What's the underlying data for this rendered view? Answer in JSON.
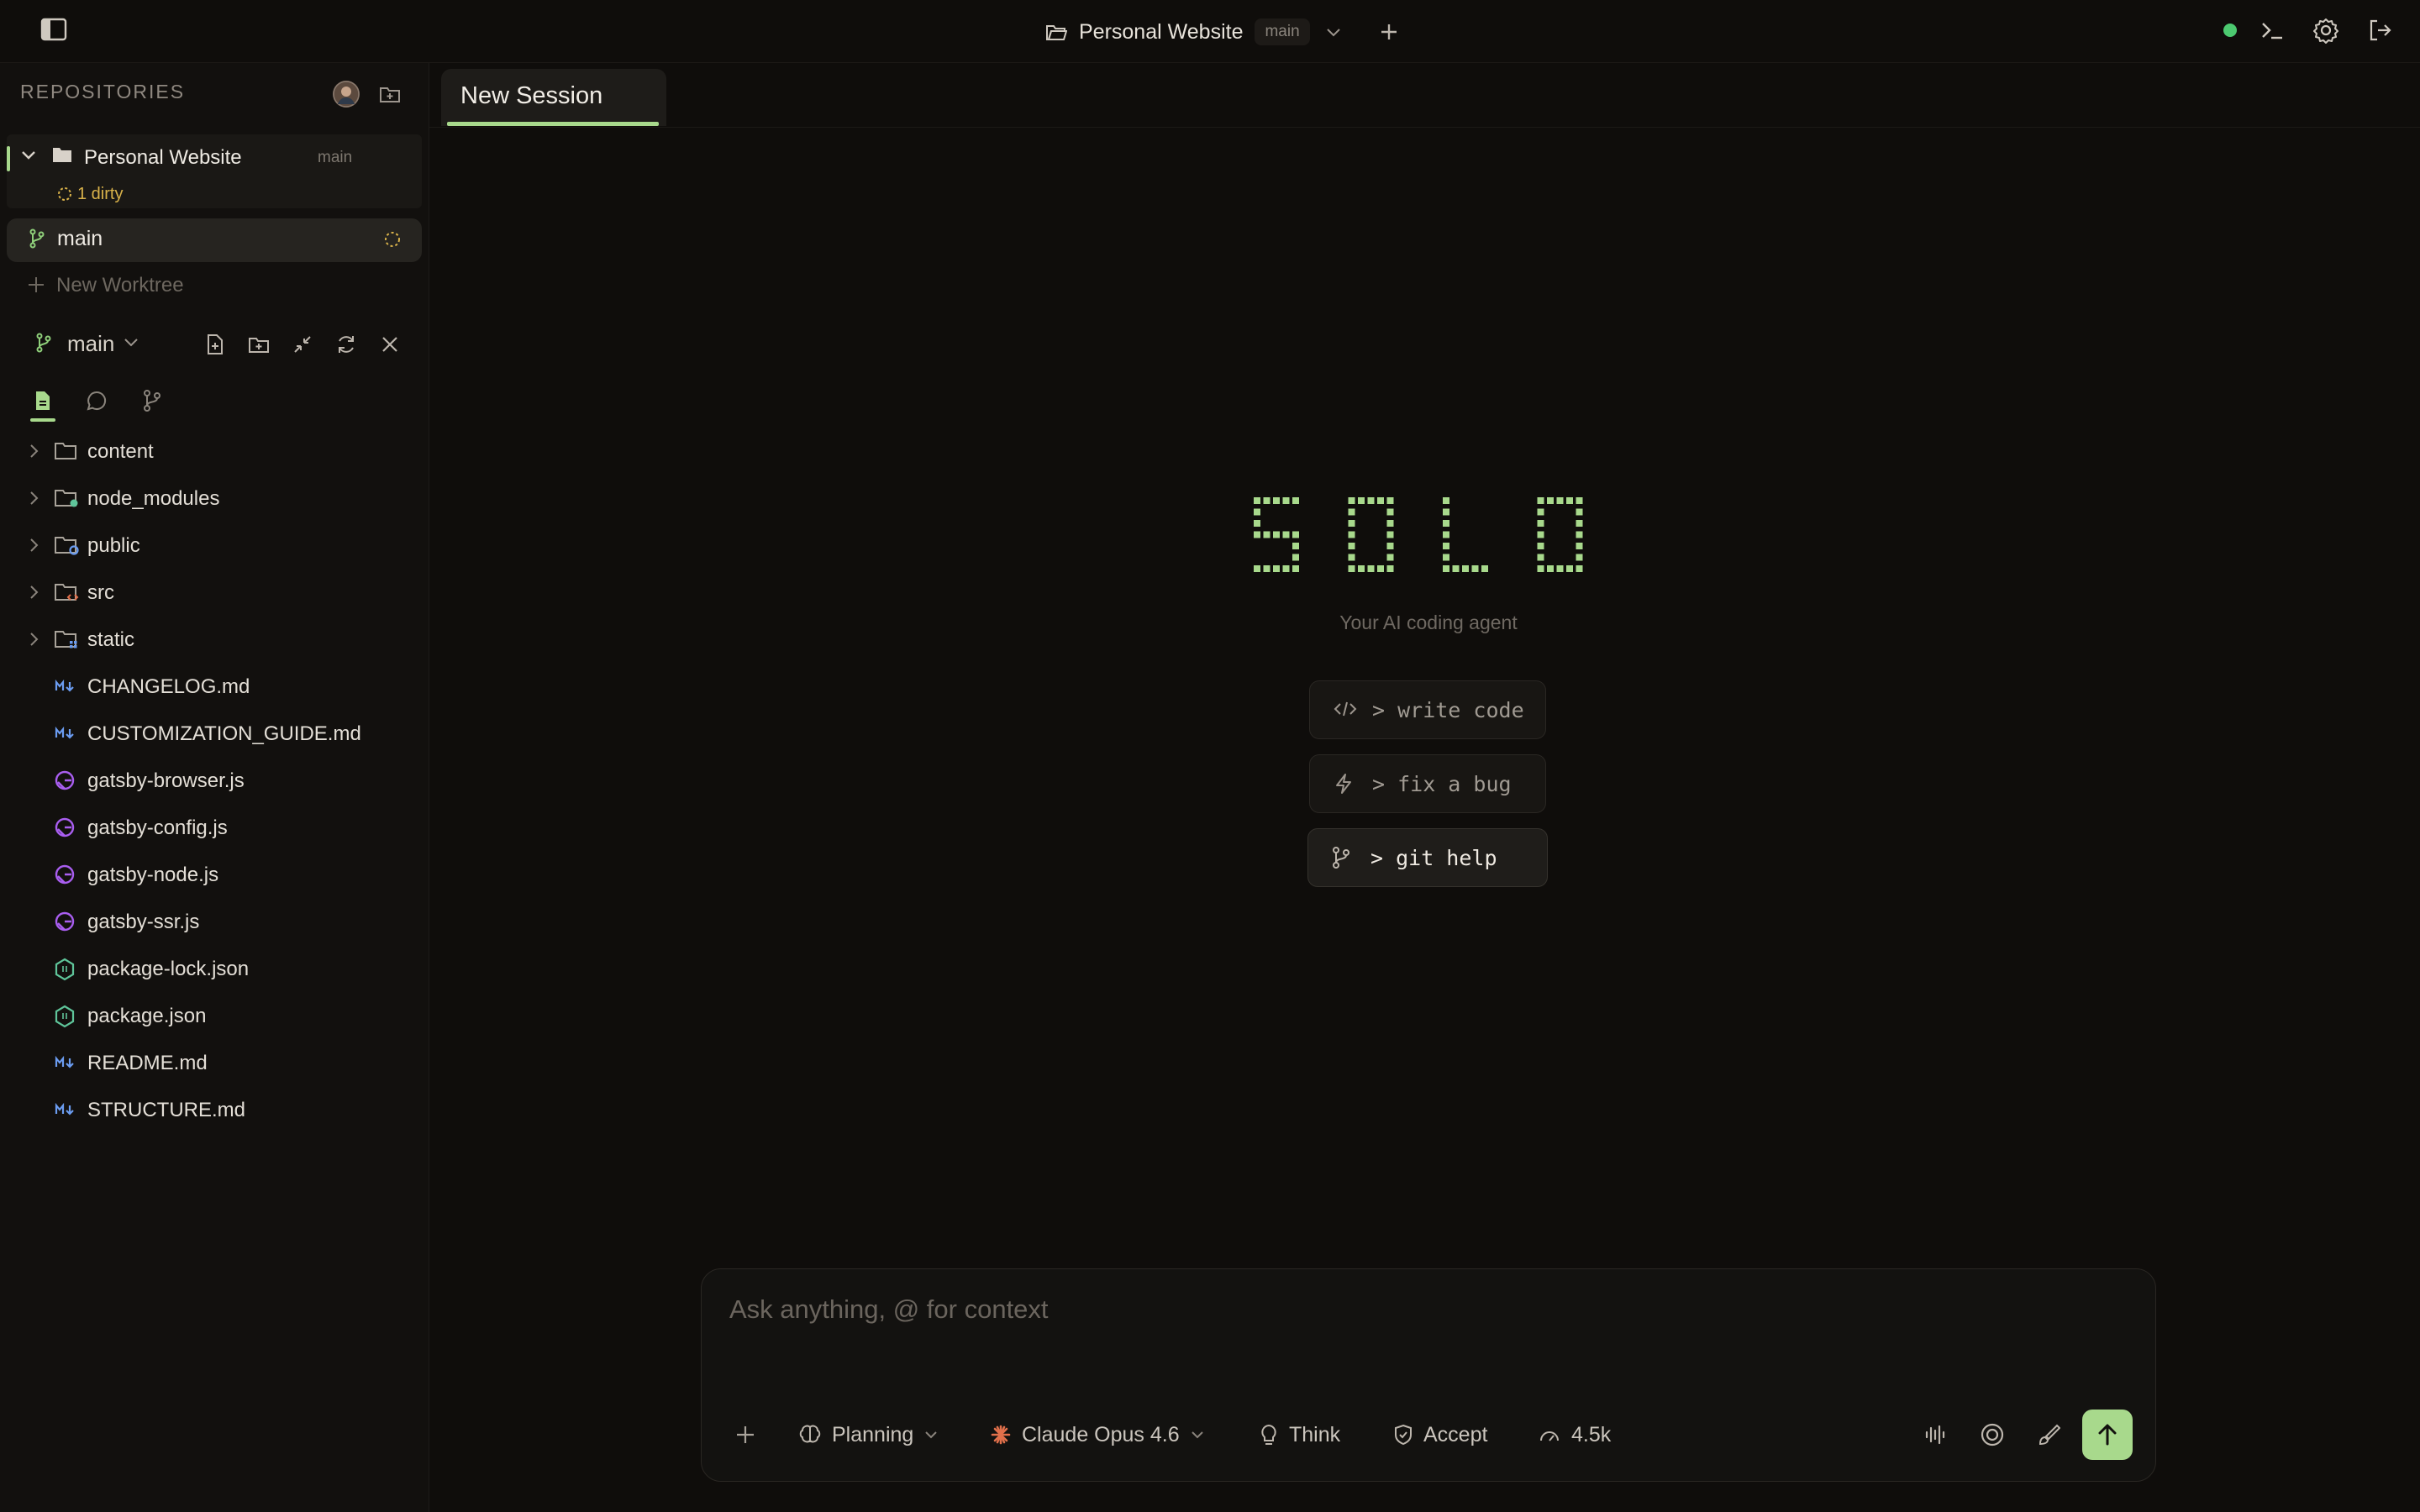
{
  "topbar": {
    "project_name": "Personal Website",
    "branch": "main"
  },
  "sidebar": {
    "header": "REPOSITORIES",
    "repo": {
      "name": "Personal Website",
      "branch": "main",
      "dirty": "1 dirty"
    },
    "worktree": "main",
    "new_worktree": "New Worktree",
    "branch_selector": "main",
    "files": [
      {
        "name": "content",
        "type": "folder",
        "icon": "folder-icon"
      },
      {
        "name": "node_modules",
        "type": "folder",
        "icon": "node-modules-folder-icon"
      },
      {
        "name": "public",
        "type": "folder",
        "icon": "public-folder-icon"
      },
      {
        "name": "src",
        "type": "folder",
        "icon": "src-folder-icon"
      },
      {
        "name": "static",
        "type": "folder",
        "icon": "static-folder-icon"
      },
      {
        "name": "CHANGELOG.md",
        "type": "file",
        "icon": "markdown-icon"
      },
      {
        "name": "CUSTOMIZATION_GUIDE.md",
        "type": "file",
        "icon": "markdown-icon"
      },
      {
        "name": "gatsby-browser.js",
        "type": "file",
        "icon": "gatsby-icon"
      },
      {
        "name": "gatsby-config.js",
        "type": "file",
        "icon": "gatsby-icon"
      },
      {
        "name": "gatsby-node.js",
        "type": "file",
        "icon": "gatsby-icon"
      },
      {
        "name": "gatsby-ssr.js",
        "type": "file",
        "icon": "gatsby-icon"
      },
      {
        "name": "package-lock.json",
        "type": "file",
        "icon": "nodejs-icon"
      },
      {
        "name": "package.json",
        "type": "file",
        "icon": "nodejs-icon"
      },
      {
        "name": "README.md",
        "type": "file",
        "icon": "markdown-icon"
      },
      {
        "name": "STRUCTURE.md",
        "type": "file",
        "icon": "markdown-icon"
      }
    ]
  },
  "tabs": [
    {
      "label": "New Session"
    }
  ],
  "hero": {
    "logo_text": "SOLO",
    "subtitle": "Your AI coding agent",
    "actions": [
      {
        "label": "> write code",
        "icon": "code-icon"
      },
      {
        "label": "> fix a bug",
        "icon": "lightning-icon"
      },
      {
        "label": "> git help",
        "icon": "git-branch-icon"
      }
    ]
  },
  "composer": {
    "placeholder": "Ask anything, @ for context",
    "mode": "Planning",
    "model": "Claude Opus 4.6",
    "think": "Think",
    "accept": "Accept",
    "tokens": "4.5k"
  },
  "colors": {
    "accent": "#a8d98c",
    "dirty": "#d9b24a",
    "status_dot": "#4cc970",
    "claude": "#e1704b",
    "markdown": "#6b9cf0",
    "gatsby": "#a95ef0",
    "node": "#5fc59a"
  }
}
